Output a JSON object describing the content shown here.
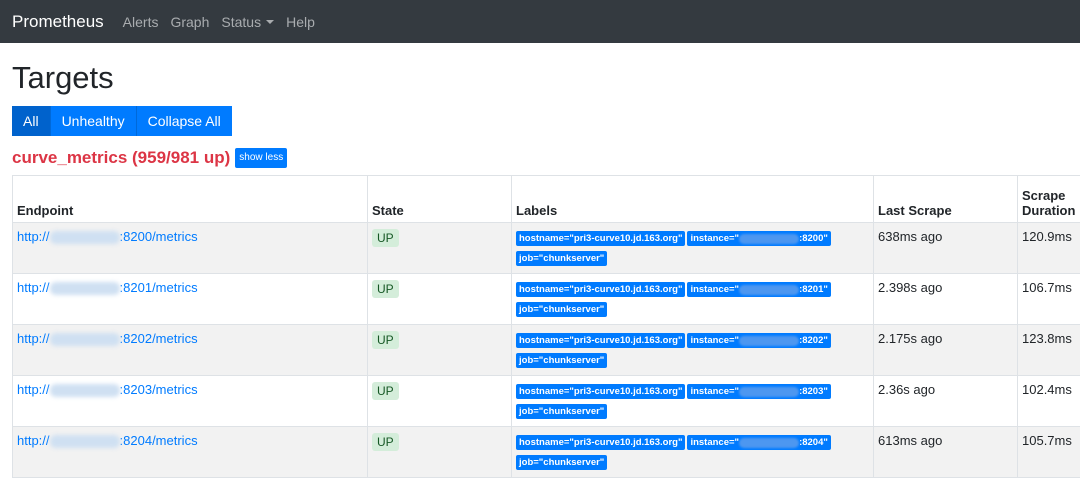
{
  "navbar": {
    "brand": "Prometheus",
    "links": [
      "Alerts",
      "Graph",
      "Status",
      "Help"
    ]
  },
  "page_title": "Targets",
  "filter_buttons": [
    "All",
    "Unhealthy",
    "Collapse All"
  ],
  "job": {
    "title": "curve_metrics (959/981 up)",
    "toggle_label": "show less"
  },
  "table": {
    "headers": {
      "endpoint": "Endpoint",
      "state": "State",
      "labels": "Labels",
      "last_scrape": "Last Scrape",
      "scrape_duration_line1": "Scrape",
      "scrape_duration_line2": "Duration"
    },
    "rows": [
      {
        "endpoint_prefix": "http://",
        "endpoint_suffix": ":8200/metrics",
        "state": "UP",
        "label_hostname": "hostname=\"pri3-curve10.jd.163.org\"",
        "label_instance_prefix": "instance=\"",
        "label_instance_suffix": ":8200\"",
        "label_job": "job=\"chunkserver\"",
        "last_scrape": "638ms ago",
        "duration": "120.9ms"
      },
      {
        "endpoint_prefix": "http://",
        "endpoint_suffix": ":8201/metrics",
        "state": "UP",
        "label_hostname": "hostname=\"pri3-curve10.jd.163.org\"",
        "label_instance_prefix": "instance=\"",
        "label_instance_suffix": ":8201\"",
        "label_job": "job=\"chunkserver\"",
        "last_scrape": "2.398s ago",
        "duration": "106.7ms"
      },
      {
        "endpoint_prefix": "http://",
        "endpoint_suffix": ":8202/metrics",
        "state": "UP",
        "label_hostname": "hostname=\"pri3-curve10.jd.163.org\"",
        "label_instance_prefix": "instance=\"",
        "label_instance_suffix": ":8202\"",
        "label_job": "job=\"chunkserver\"",
        "last_scrape": "2.175s ago",
        "duration": "123.8ms"
      },
      {
        "endpoint_prefix": "http://",
        "endpoint_suffix": ":8203/metrics",
        "state": "UP",
        "label_hostname": "hostname=\"pri3-curve10.jd.163.org\"",
        "label_instance_prefix": "instance=\"",
        "label_instance_suffix": ":8203\"",
        "label_job": "job=\"chunkserver\"",
        "last_scrape": "2.36s ago",
        "duration": "102.4ms"
      },
      {
        "endpoint_prefix": "http://",
        "endpoint_suffix": ":8204/metrics",
        "state": "UP",
        "label_hostname": "hostname=\"pri3-curve10.jd.163.org\"",
        "label_instance_prefix": "instance=\"",
        "label_instance_suffix": ":8204\"",
        "label_job": "job=\"chunkserver\"",
        "last_scrape": "613ms ago",
        "duration": "105.7ms"
      }
    ]
  }
}
